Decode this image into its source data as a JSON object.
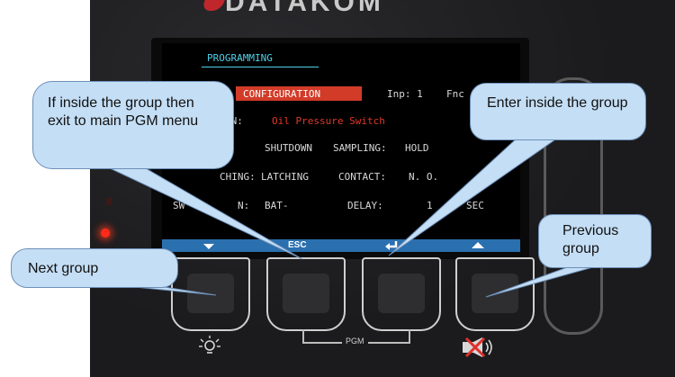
{
  "brand": {
    "name": "DATAKOM"
  },
  "lcd": {
    "header": "PROGRAMMING",
    "section": "CONFIGURATION",
    "inp_label": "Inp: 1",
    "fnc_label": "Fnc",
    "row1": {
      "label_fragment": "ON:",
      "value": "Oil Pressure Switch"
    },
    "row2": {
      "value1": "SHUTDOWN",
      "label2": "SAMPLING:",
      "value2": "HOLD"
    },
    "row3": {
      "label_fragment": "CHING:",
      "value1": "LATCHING",
      "label2": "CONTACT:",
      "value2": "N. O."
    },
    "row4": {
      "label_fragment": "SW",
      "label_fragment2": "N:",
      "value1": "BAT-",
      "label2": "DELAY:",
      "value2": "1",
      "unit": "SEC"
    },
    "softkeys": {
      "esc": "ESC"
    }
  },
  "panel": {
    "pgm_label": "PGM"
  },
  "callouts": {
    "exit": "If inside the group then exit to main PGM menu",
    "enter": "Enter inside the group",
    "next": "Next group",
    "previous": "Previous group"
  },
  "colors": {
    "panel": "#1b1b1d",
    "lcd_header": "#4fd0e8",
    "lcd_highlight": "#d13b28",
    "softkey_bar": "#2a6fae",
    "callout_fill": "#c4def5",
    "led": "#ff2a1a"
  },
  "icons": [
    "arrow-down-icon",
    "enter-icon",
    "arrow-up-icon",
    "lamp-icon",
    "mute-horn-icon"
  ]
}
